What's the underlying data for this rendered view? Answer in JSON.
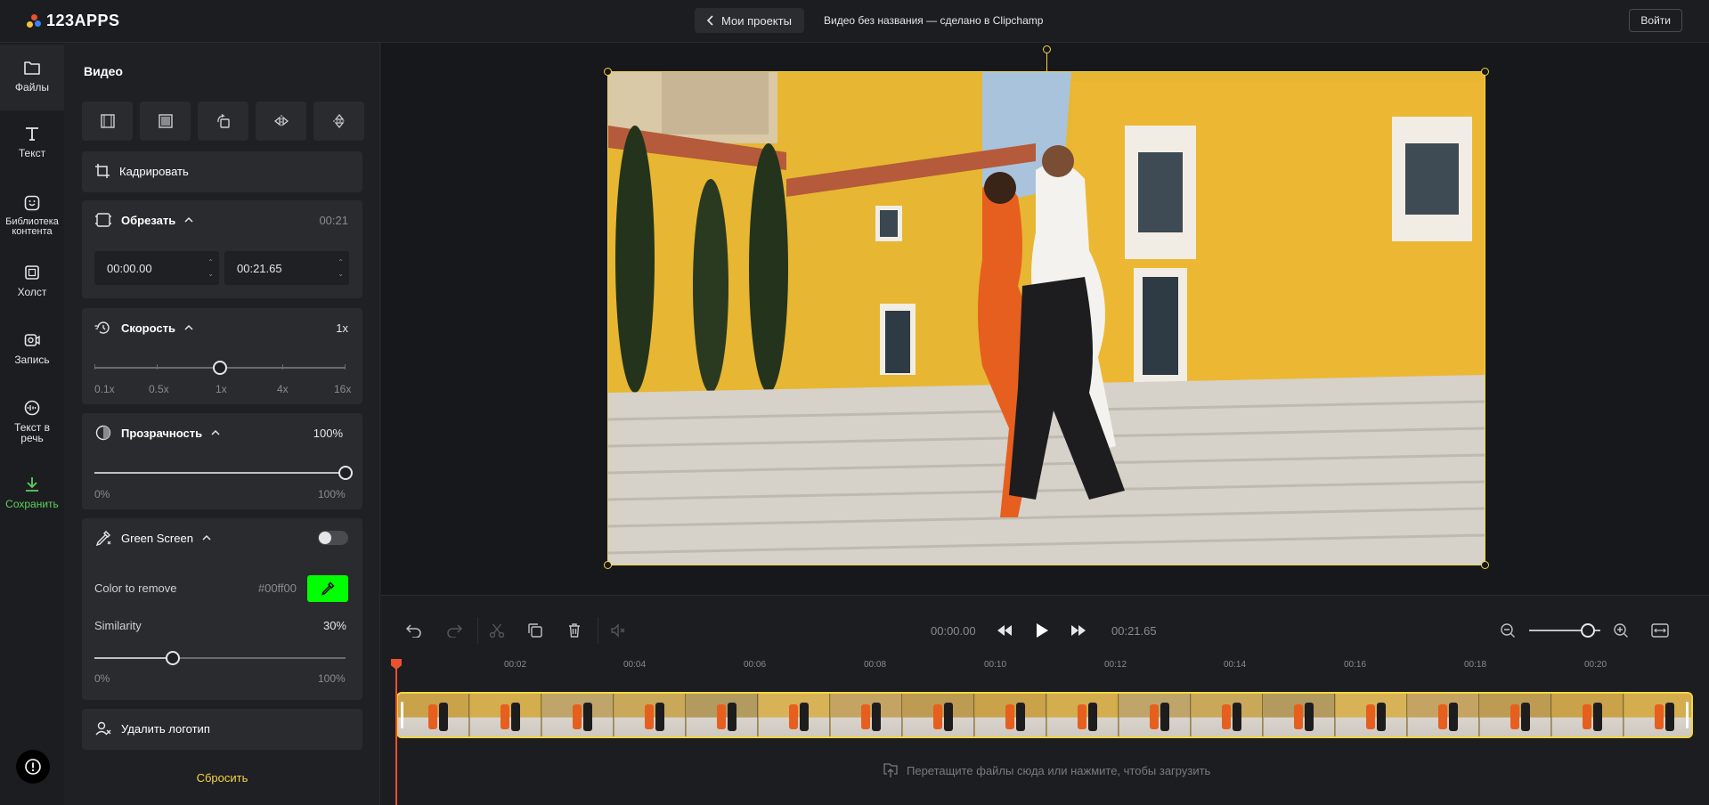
{
  "app": {
    "logo_text": "123APPS",
    "back_button_label": "Мои проекты",
    "document_title": "Видео без названия — сделано в Clipchamp",
    "login_label": "Войти"
  },
  "nav": {
    "items": [
      {
        "label": "Файлы",
        "icon": "folder-icon"
      },
      {
        "label": "Текст",
        "icon": "text-icon"
      },
      {
        "label": "Библиотека контента",
        "icon": "sticker-icon"
      },
      {
        "label": "Холст",
        "icon": "canvas-icon"
      },
      {
        "label": "Запись",
        "icon": "record-icon"
      },
      {
        "label": "Текст в речь",
        "icon": "speech-icon"
      },
      {
        "label": "Сохранить",
        "icon": "download-icon"
      }
    ]
  },
  "panel": {
    "title": "Видео",
    "crop_label": "Кадрировать",
    "trim": {
      "label": "Обрезать",
      "duration": "00:21",
      "start": "00:00.00",
      "end": "00:21.65"
    },
    "speed": {
      "label": "Скорость",
      "value": "1x",
      "marks": [
        "0.1x",
        "0.5x",
        "1x",
        "4x",
        "16x"
      ],
      "position": 0.5
    },
    "opacity": {
      "label": "Прозрачность",
      "value": "100%",
      "min": "0%",
      "max": "100%",
      "position": 1.0
    },
    "green_screen": {
      "label": "Green Screen",
      "enabled": false,
      "color_label": "Color to remove",
      "color_value": "#00ff00",
      "color_text": "#00ff00",
      "similarity_label": "Similarity",
      "similarity_value": "30%",
      "min": "0%",
      "max": "100%",
      "position": 0.3
    },
    "remove_logo_label": "Удалить логотип",
    "reset_label": "Сбросить"
  },
  "timeline": {
    "current_time": "00:00.00",
    "total_time": "00:21.65",
    "ruler": [
      "00:02",
      "00:04",
      "00:06",
      "00:08",
      "00:10",
      "00:12",
      "00:14",
      "00:16",
      "00:18",
      "00:20"
    ],
    "drop_hint": "Перетащите файлы сюда или нажмите, чтобы загрузить",
    "zoom_position": 0.7
  },
  "colors": {
    "accent": "#f2d544",
    "save_green": "#5cd05c",
    "playhead": "#e8522f",
    "green_swatch": "#00ff00"
  }
}
